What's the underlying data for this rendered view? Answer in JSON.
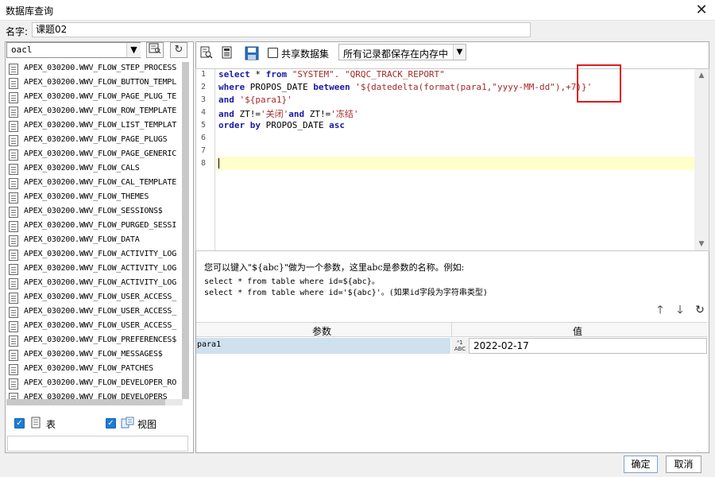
{
  "window": {
    "title": "数据库查询",
    "close_glyph": "✕"
  },
  "name_field": {
    "label": "名字:",
    "value": "课题02"
  },
  "left": {
    "datasource": "oacl",
    "tree_items": [
      "APEX_030200.WWV_FLOW_STEP_PROCESS",
      "APEX_030200.WWV_FLOW_BUTTON_TEMPL",
      "APEX_030200.WWV_FLOW_PAGE_PLUG_TE",
      "APEX_030200.WWV_FLOW_ROW_TEMPLATE",
      "APEX_030200.WWV_FLOW_LIST_TEMPLAT",
      "APEX_030200.WWV_FLOW_PAGE_PLUGS",
      "APEX_030200.WWV_FLOW_PAGE_GENERIC",
      "APEX_030200.WWV_FLOW_CALS",
      "APEX_030200.WWV_FLOW_CAL_TEMPLATE",
      "APEX_030200.WWV_FLOW_THEMES",
      "APEX_030200.WWV_FLOW_SESSIONS$",
      "APEX_030200.WWV_FLOW_PURGED_SESSI",
      "APEX_030200.WWV_FLOW_DATA",
      "APEX_030200.WWV_FLOW_ACTIVITY_LOG",
      "APEX_030200.WWV_FLOW_ACTIVITY_LOG",
      "APEX_030200.WWV_FLOW_ACTIVITY_LOG",
      "APEX_030200.WWV_FLOW_USER_ACCESS_",
      "APEX_030200.WWV_FLOW_USER_ACCESS_",
      "APEX_030200.WWV_FLOW_USER_ACCESS_",
      "APEX_030200.WWV_FLOW_PREFERENCES$",
      "APEX_030200.WWV_FLOW_MESSAGES$",
      "APEX_030200.WWV_FLOW_PATCHES",
      "APEX_030200.WWV_FLOW_DEVELOPER_RO",
      "APEX_030200.WWV_FLOW_DEVELOPERS"
    ],
    "filter_table_label": "表",
    "filter_view_label": "视图"
  },
  "toolbar": {
    "share_label": "共享数据集",
    "storage_option": "所有记录都保存在内存中"
  },
  "editor": {
    "line_numbers": [
      "1",
      "2",
      "3",
      "4",
      "5",
      "6",
      "7",
      "8"
    ],
    "line1": {
      "k1": "select",
      "t1": " * ",
      "k2": "from",
      "t2": " ",
      "s1": "\"SYSTEM\". \"QRQC_TRACK_REPORT\""
    },
    "line2": {
      "k1": "where",
      "t1": " PROPOS_DATE ",
      "k2": "between",
      "t2": " ",
      "s1": "'${datedelta(format(para1,\"yyyy-MM-dd\"),+7)}'"
    },
    "line3": {
      "k1": "and",
      "t1": " ",
      "s1": "'${para1}'"
    },
    "line4": {
      "k1": "and",
      "t1": " ZT!=",
      "s1": "'关闭'",
      "k2": "and",
      "t2": " ZT!=",
      "s2": "'冻结'"
    },
    "line5": {
      "k1": "order",
      "t1": " ",
      "k2": "by",
      "t2": " PROPOS_DATE ",
      "k3": "asc"
    }
  },
  "help": {
    "line1": "您可以键入\"${abc}\"做为一个参数，这里abc是参数的名称。例如:",
    "line2": "select * from table where id=${abc}。",
    "line3": "select * from table where id='${abc}'。(如果id字段为字符串类型)"
  },
  "params": {
    "col_param": "参数",
    "col_value": "值",
    "rows": [
      {
        "name": "para1",
        "type_top": "ᴬ1",
        "type_bottom": "ABC",
        "value": "2022-02-17"
      }
    ]
  },
  "buttons": {
    "ok": "确定",
    "cancel": "取消"
  }
}
